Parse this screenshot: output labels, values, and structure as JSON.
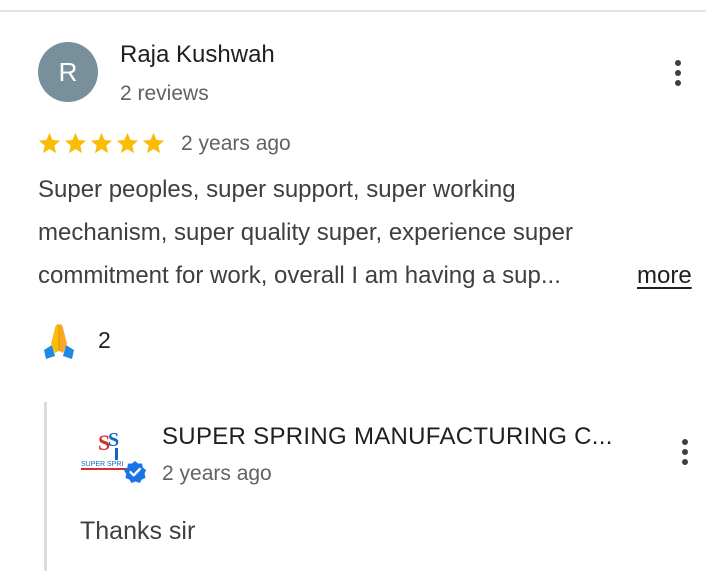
{
  "review": {
    "avatar_initial": "R",
    "reviewer_name": "Raja Kushwah",
    "reviewer_meta": "2 reviews",
    "rating": 5,
    "rating_max": 5,
    "time": "2 years ago",
    "text_lines": [
      "Super peoples, super support, super working",
      "mechanism, super quality super, experience super",
      "commitment for work, overall I am having a sup..."
    ],
    "more_label": "more",
    "reaction": {
      "icon": "folded-hands-emoji",
      "count": "2"
    }
  },
  "reply": {
    "owner_name": "SUPER SPRING MANUFACTURING C...",
    "logo_text": "SUPER SPRI",
    "verified_icon": "verified-badge-icon",
    "time": "2 years ago",
    "text": "Thanks sir"
  },
  "colors": {
    "star": "#fbbc04",
    "avatar_bg": "#78909c",
    "verified": "#1a73e8",
    "text_primary": "#1f1f1f",
    "text_secondary": "#5f6368"
  }
}
